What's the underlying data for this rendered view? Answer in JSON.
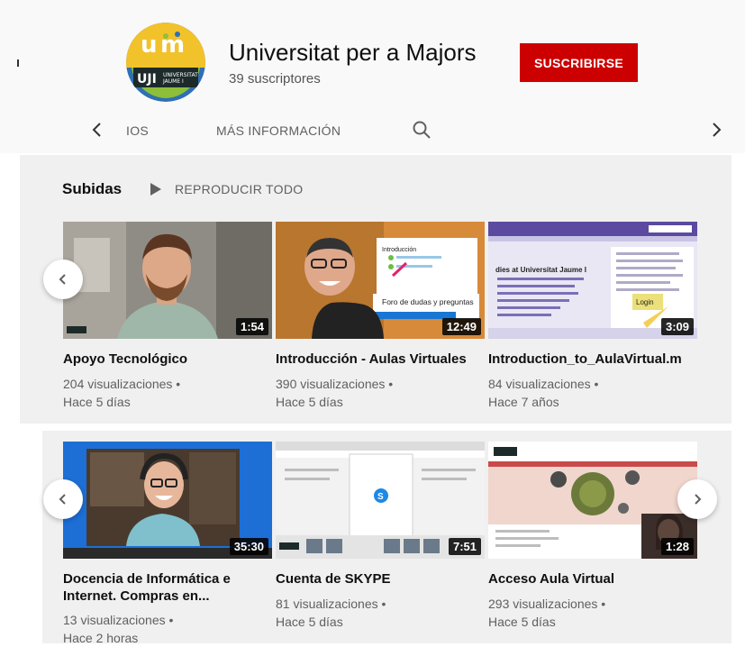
{
  "channel": {
    "name": "Universitat per a Majors",
    "subscribers": "39 suscriptores",
    "subscribe_label": "SUSCRIBIRSE",
    "logo_text": "UNIVERSITAT JAUME I"
  },
  "tabs": {
    "partial": "IOS",
    "more_info": "MÁS INFORMACIÓN"
  },
  "section": {
    "title": "Subidas",
    "play_all": "REPRODUCIR TODO"
  },
  "videos": [
    {
      "title": "Apoyo Tecnológico",
      "views": "204 visualizaciones •",
      "age": "Hace 5 días",
      "duration": "1:54"
    },
    {
      "title": "Introducción - Aulas Virtuales",
      "views": "390 visualizaciones •",
      "age": "Hace 5 días",
      "duration": "12:49"
    },
    {
      "title": "Introduction_to_AulaVirtual.m",
      "views": "84 visualizaciones •",
      "age": "Hace 7 años",
      "duration": "3:09"
    },
    {
      "title": "Docencia de Informática e Internet. Compras en...",
      "views": "13 visualizaciones •",
      "age": "Hace 2 horas",
      "duration": "35:30"
    },
    {
      "title": "Cuenta de SKYPE",
      "views": "81 visualizaciones •",
      "age": "Hace 5 días",
      "duration": "7:51"
    },
    {
      "title": "Acceso Aula Virtual",
      "views": "293 visualizaciones •",
      "age": "Hace 5 días",
      "duration": "1:28"
    }
  ],
  "thumb_text": {
    "intro_heading": "Introducción",
    "foro": "Foro de dudas y preguntas",
    "aula_heading": "dies at Universitat Jaume I",
    "login": "Login"
  },
  "colors": {
    "subscribe": "#cc0000",
    "logo_yellow": "#f2c22b",
    "logo_green": "#8dbf3a",
    "logo_blue": "#2f6fb3"
  },
  "icons": [
    "chevron-left-icon",
    "chevron-right-icon",
    "search-icon",
    "play-icon"
  ]
}
